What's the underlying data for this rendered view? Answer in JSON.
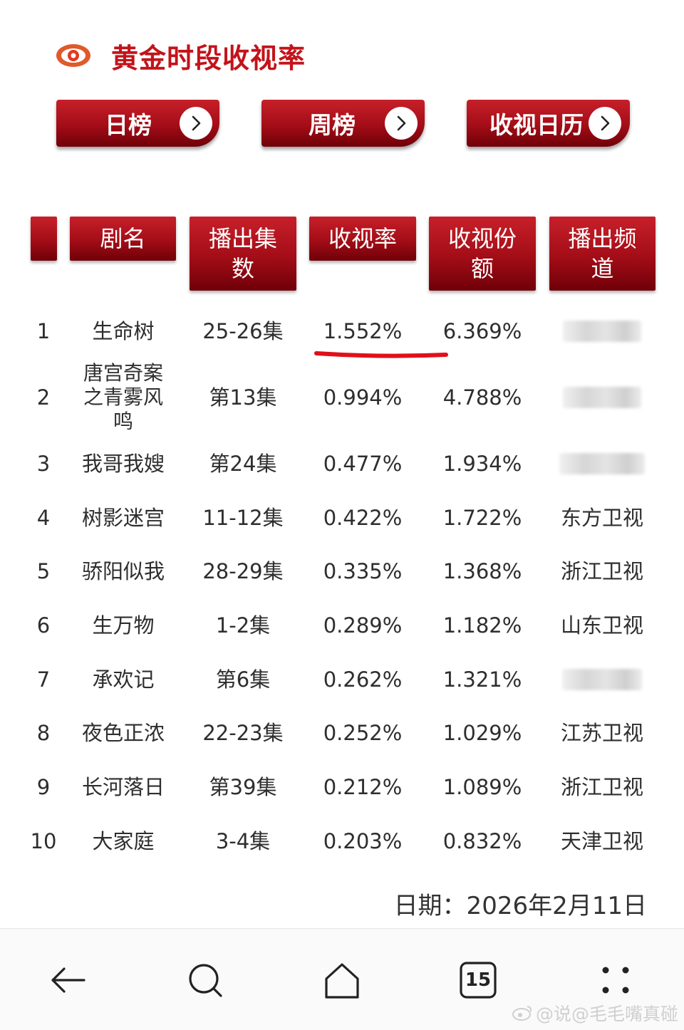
{
  "header": {
    "title": "黄金时段收视率"
  },
  "nav": [
    {
      "label": "日榜"
    },
    {
      "label": "周榜"
    },
    {
      "label": "收视日历"
    }
  ],
  "columns": [
    "",
    "剧名",
    "播出集数",
    "收视率",
    "收视份额",
    "播出频道"
  ],
  "rows": [
    {
      "rank": "1",
      "name": "生命树",
      "episodes": "25-26集",
      "rating": "1.552%",
      "share": "6.369%",
      "channel": ""
    },
    {
      "rank": "2",
      "name": "唐宫奇案之青雾风鸣",
      "episodes": "第13集",
      "rating": "0.994%",
      "share": "4.788%",
      "channel": ""
    },
    {
      "rank": "3",
      "name": "我哥我嫂",
      "episodes": "第24集",
      "rating": "0.477%",
      "share": "1.934%",
      "channel": ""
    },
    {
      "rank": "4",
      "name": "树影迷宫",
      "episodes": "11-12集",
      "rating": "0.422%",
      "share": "1.722%",
      "channel": "东方卫视"
    },
    {
      "rank": "5",
      "name": "骄阳似我",
      "episodes": "28-29集",
      "rating": "0.335%",
      "share": "1.368%",
      "channel": "浙江卫视"
    },
    {
      "rank": "6",
      "name": "生万物",
      "episodes": "1-2集",
      "rating": "0.289%",
      "share": "1.182%",
      "channel": "山东卫视"
    },
    {
      "rank": "7",
      "name": "承欢记",
      "episodes": "第6集",
      "rating": "0.262%",
      "share": "1.321%",
      "channel": ""
    },
    {
      "rank": "8",
      "name": "夜色正浓",
      "episodes": "22-23集",
      "rating": "0.252%",
      "share": "1.029%",
      "channel": "江苏卫视"
    },
    {
      "rank": "9",
      "name": "长河落日",
      "episodes": "第39集",
      "rating": "0.212%",
      "share": "1.089%",
      "channel": "浙江卫视"
    },
    {
      "rank": "10",
      "name": "大家庭",
      "episodes": "3-4集",
      "rating": "0.203%",
      "share": "0.832%",
      "channel": "天津卫视"
    }
  ],
  "date_line": "日期：2026年2月11日",
  "bottom_nav": {
    "tab_count": "15",
    "icons": [
      "back-arrow-icon",
      "search-icon",
      "home-icon",
      "tabs-icon",
      "more-icon"
    ]
  },
  "watermark": "@说@毛毛嘴真碰",
  "colors": {
    "accent_red": "#c3131a",
    "button_dark_red": "#a30d17",
    "underline_red": "#e0101a"
  }
}
